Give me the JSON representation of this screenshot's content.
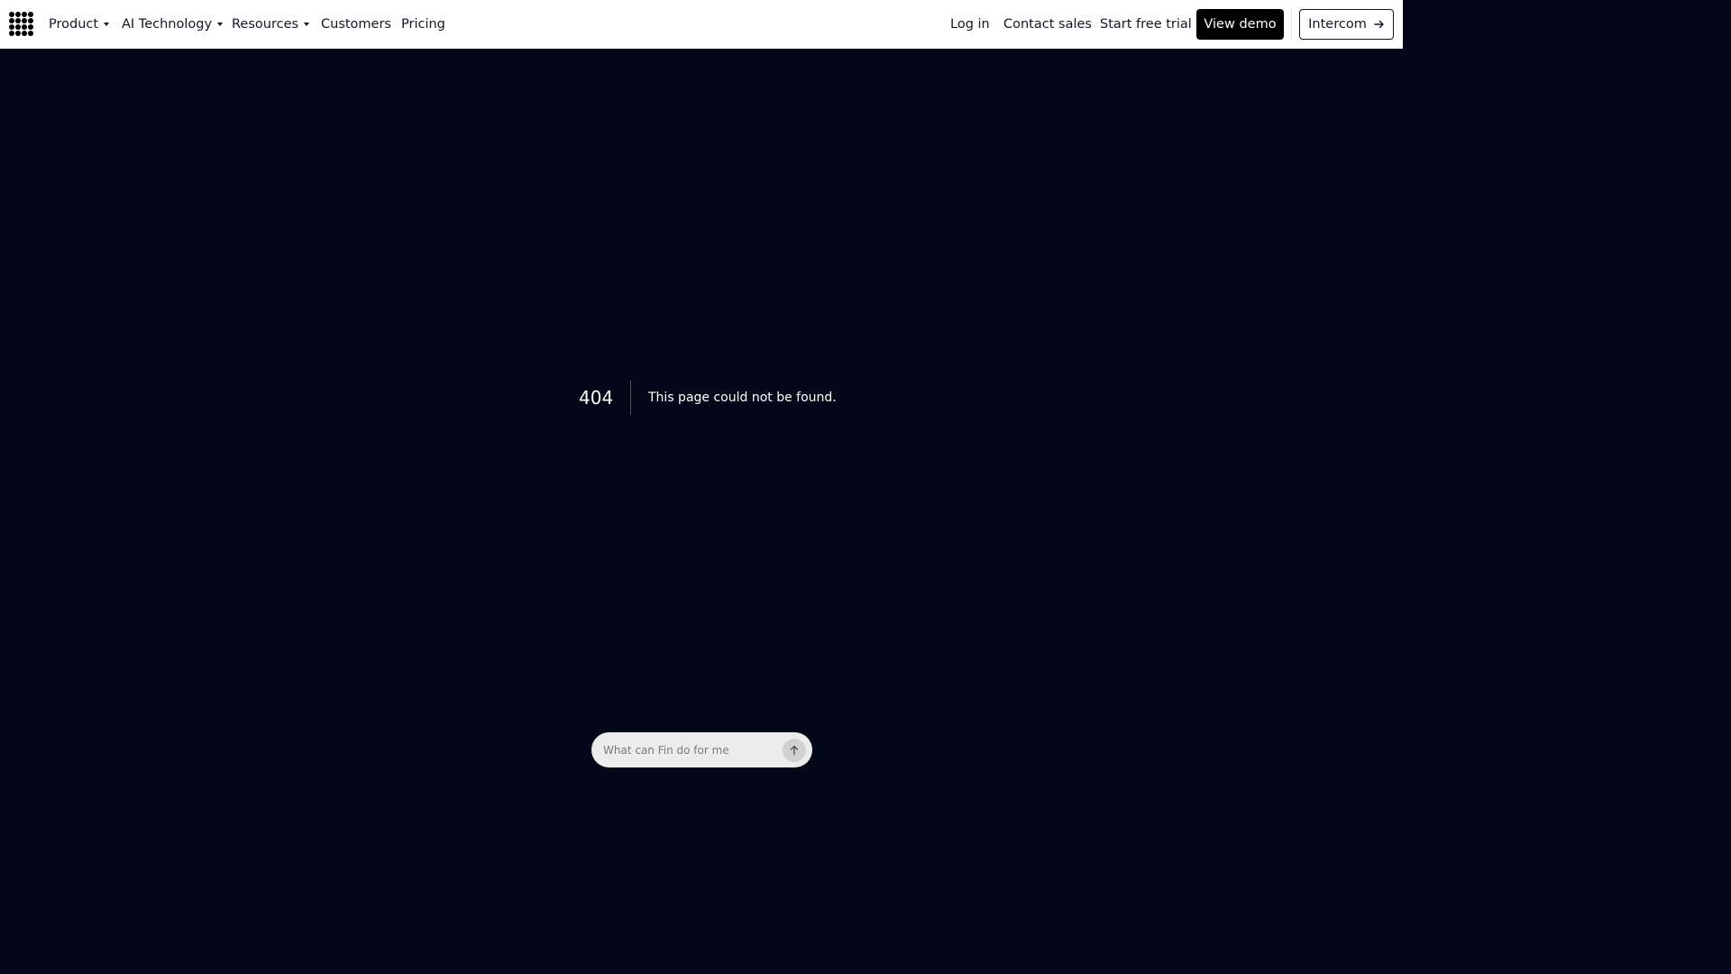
{
  "nav": {
    "product": "Product",
    "ai_technology": "AI Technology",
    "resources": "Resources",
    "customers": "Customers",
    "pricing": "Pricing",
    "log_in": "Log in",
    "contact_sales": "Contact sales",
    "start_free_trial": "Start free trial",
    "view_demo": "View demo",
    "intercom": "Intercom"
  },
  "error": {
    "code": "404",
    "message": "This page could not be found."
  },
  "fin": {
    "placeholder": "What can Fin do for me"
  },
  "icons": {
    "logo": "intercom-logo-icon",
    "dropdown": "caret-down-icon",
    "arrow": "arrow-right-icon",
    "send": "arrow-up-icon"
  },
  "colors": {
    "page_background": "#020817",
    "navbar_background": "#ffffff",
    "primary_button": "#000000",
    "input_background": "#ececec"
  }
}
